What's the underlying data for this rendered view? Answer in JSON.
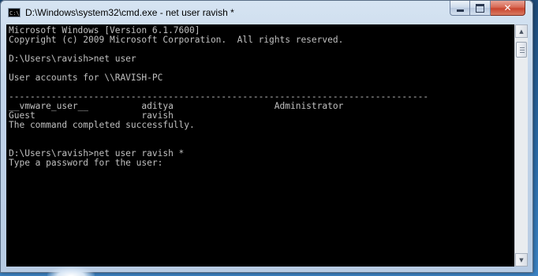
{
  "window": {
    "title": "D:\\Windows\\system32\\cmd.exe - net  user ravish *",
    "icon_label": "C:\\",
    "controls": {
      "minimize_icon": "minimize-icon",
      "maximize_icon": "maximize-icon",
      "close_glyph": "✕"
    }
  },
  "console": {
    "lines": [
      "Microsoft Windows [Version 6.1.7600]",
      "Copyright (c) 2009 Microsoft Corporation.  All rights reserved.",
      "",
      "D:\\Users\\ravish>net user",
      "",
      "User accounts for \\\\RAVISH-PC",
      "",
      "-------------------------------------------------------------------------------",
      "__vmware_user__          aditya                   Administrator",
      "Guest                    ravish",
      "The command completed successfully.",
      "",
      "",
      "D:\\Users\\ravish>net user ravish *",
      "Type a password for the user:"
    ],
    "text_color": "#c0c0c0",
    "background_color": "#000000"
  },
  "scrollbar": {
    "up_glyph": "▲",
    "down_glyph": "▼"
  }
}
